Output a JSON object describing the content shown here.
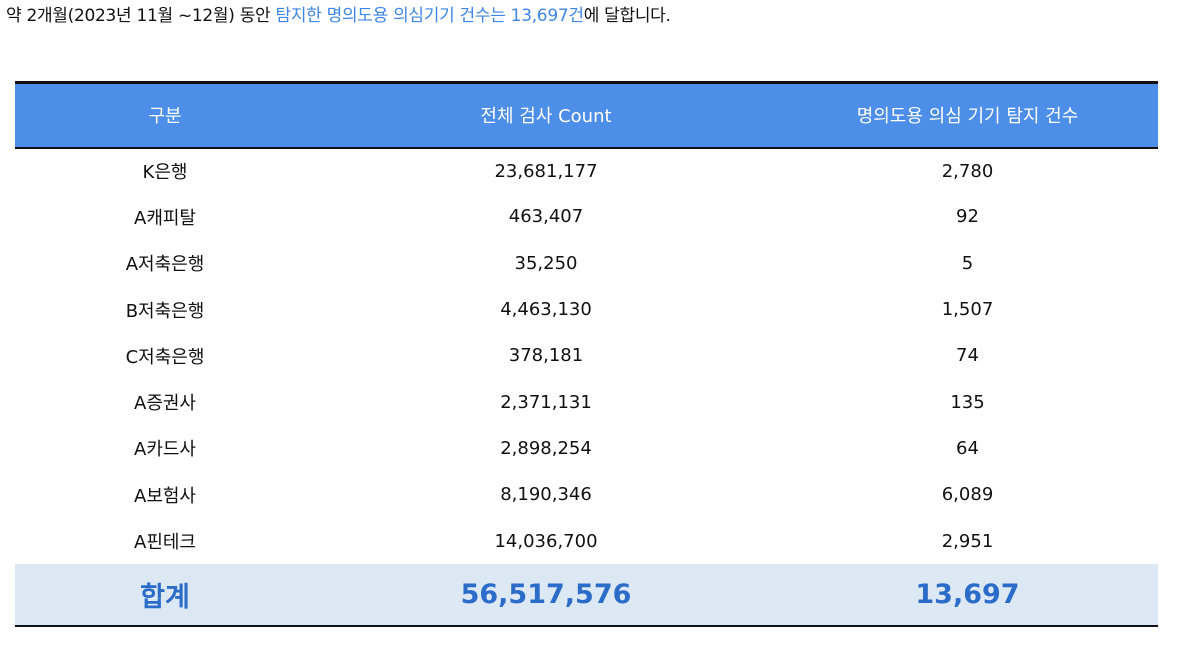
{
  "intro": {
    "prefix": "약 2개월(2023년 11월 ~12월) 동안 ",
    "highlight": "탐지한 명의도용 의심기기 건수는 13,697건",
    "suffix": "에 달합니다."
  },
  "table": {
    "headers": [
      "구분",
      "전체 검사 Count",
      "명의도용 의심 기기 탐지 건수"
    ],
    "rows": [
      {
        "name": "K은행",
        "count": "23,681,177",
        "detected": "2,780"
      },
      {
        "name": "A캐피탈",
        "count": "463,407",
        "detected": "92"
      },
      {
        "name": "A저축은행",
        "count": "35,250",
        "detected": "5"
      },
      {
        "name": "B저축은행",
        "count": "4,463,130",
        "detected": "1,507"
      },
      {
        "name": "C저축은행",
        "count": "378,181",
        "detected": "74"
      },
      {
        "name": "A증권사",
        "count": "2,371,131",
        "detected": "135"
      },
      {
        "name": "A카드사",
        "count": "2,898,254",
        "detected": "64"
      },
      {
        "name": "A보험사",
        "count": "8,190,346",
        "detected": "6,089"
      },
      {
        "name": "A핀테크",
        "count": "14,036,700",
        "detected": "2,951"
      }
    ],
    "total": {
      "name": "합계",
      "count": "56,517,576",
      "detected": "13,697"
    }
  },
  "colors": {
    "header_bg": "#4c8ee8",
    "highlight_text": "#3f86e6",
    "total_bg": "#dde8f5",
    "total_text": "#2a6cc8"
  }
}
